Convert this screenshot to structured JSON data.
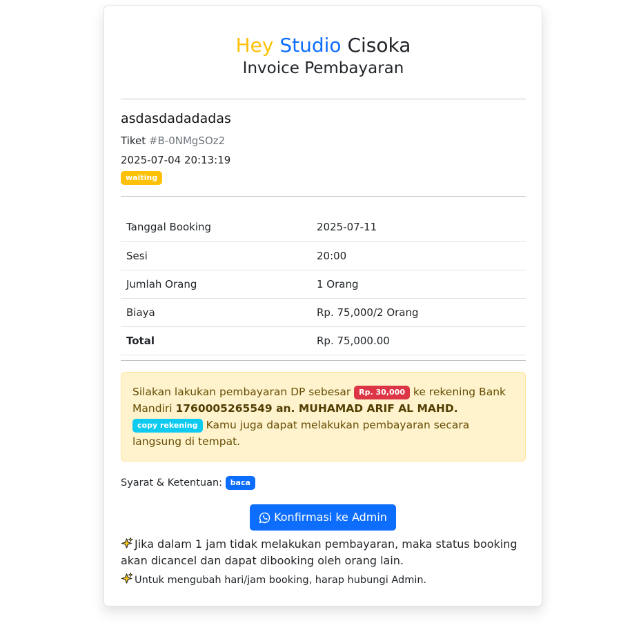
{
  "header": {
    "brand_part1": "Hey",
    "brand_part2": "Studio",
    "brand_part3": "Cisoka",
    "subtitle": "Invoice Pembayaran"
  },
  "customer": {
    "name": "asdasdadadadas",
    "ticket_label": "Tiket",
    "ticket_code": "#B-0NMgSOz2",
    "created_at": "2025-07-04 20:13:19",
    "status": "waiting"
  },
  "details": [
    {
      "label": "Tanggal Booking",
      "value": "2025-07-11"
    },
    {
      "label": "Sesi",
      "value": "20:00"
    },
    {
      "label": "Jumlah Orang",
      "value": "1 Orang"
    },
    {
      "label": "Biaya",
      "value": "Rp. 75,000/2 Orang"
    },
    {
      "label": "Total",
      "value": "Rp. 75,000.00"
    }
  ],
  "payment": {
    "text_before": "Silakan lakukan pembayaran DP sebesar",
    "dp_amount": "Rp. 30,000",
    "text_middle": "ke rekening Bank Mandiri",
    "account": "1760005265549 an. MUHAMAD ARIF AL MAHD.",
    "copy_label": "copy rekening",
    "text_after": "Kamu juga dapat melakukan pembayaran secara langsung di tempat."
  },
  "terms": {
    "label": "Syarat & Ketentuan:",
    "read_label": "baca"
  },
  "confirm_button": "Konfirmasi ke Admin",
  "notes": {
    "note1": "Jika dalam 1 jam tidak melakukan pembayaran, maka status booking akan dicancel dan dapat dibooking oleh orang lain.",
    "note2": "Untuk mengubah hari/jam booking, harap hubungi Admin."
  },
  "icons": {
    "whatsapp": "whatsapp-icon",
    "sparkle": "sparkles-icon"
  },
  "colors": {
    "brand_yellow": "#ffc107",
    "brand_blue": "#0d6efd",
    "danger": "#dc3545",
    "info": "#0dcaf0",
    "alert_bg": "#fff3cd"
  }
}
